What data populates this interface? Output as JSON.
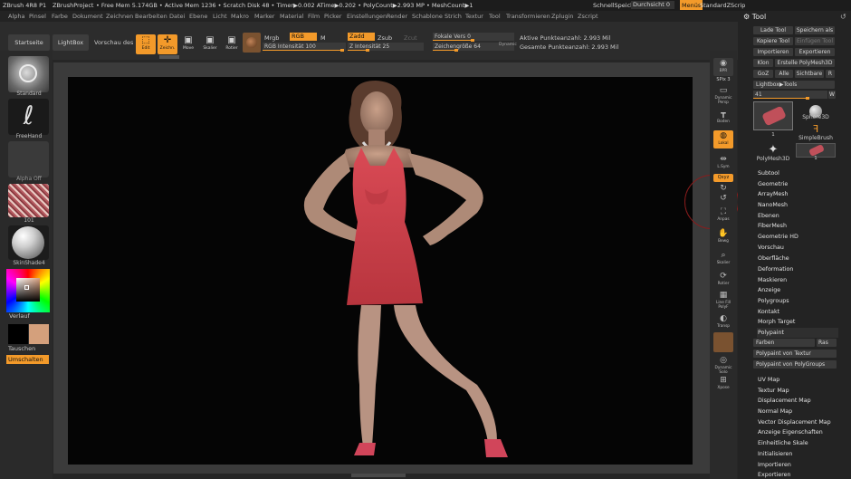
{
  "titlebar": {
    "app": "ZBrush 4R8 P1",
    "project": "ZBrushProject",
    "stats": "• Free Mem 5.174GB • Active Mem 1236 • Scratch Disk 48 • Timer▶0.002 ATime▶0.202 • PolyCount▶2.993 MP • MeshCount▶1",
    "quicksave": "SchnellSpeiche",
    "transparency": "Durchsicht 0",
    "menus": "Menüs",
    "script": "StandardZScrip"
  },
  "menubar": [
    "Alpha",
    "Pinsel",
    "Farbe",
    "Dokument",
    "Zeichnen",
    "Bearbeiten",
    "Datei",
    "Ebene",
    "Licht",
    "Makro",
    "Marker",
    "Material",
    "Film",
    "Picker",
    "Einstellungen",
    "Render",
    "Schablone",
    "Strich",
    "Textur",
    "Tool",
    "Transformieren",
    "Zplugin",
    "Zscript"
  ],
  "toolbar": {
    "startseite": "Startseite",
    "lightbox": "LightBox",
    "preview": "Vorschau des B",
    "edit": "Edit",
    "draw": "Zeichn.",
    "move": "Move",
    "scale": "Skalier",
    "rotate": "Rotier",
    "mrgb": "Mrgb",
    "rgb": "RGB",
    "m": "M",
    "rgb_intensity_label": "RGB Intensität",
    "rgb_intensity_value": "100",
    "zadd": "Zadd",
    "zsub": "Zsub",
    "zcut": "Zcut",
    "z_intensity_label": "Z Intensität",
    "z_intensity_value": "25",
    "focal_label": "Fokale Vers",
    "focal_value": "0",
    "draw_size_label": "Zeichengröße",
    "draw_size_value": "64",
    "dynamic": "Dynamic",
    "active_points": "Aktive Punkteanzahl: 2.993 Mil",
    "total_points": "Gesamte Punkteanzahl: 2.993 Mil"
  },
  "leftshelf": {
    "brush1": "Standard",
    "brush2": "FreeHand",
    "alpha": "Alpha Off",
    "texture_num": "101",
    "material": "SkinShade4",
    "gradient": "Verlauf",
    "swap": "Tauschen",
    "switch": "Umschalten"
  },
  "rightshelf": [
    "BPR",
    "SPix 3",
    "Dynamic Persp",
    "Boden",
    "Lokal",
    "L.Sym",
    "Qxyz",
    "",
    "",
    "Anpas",
    "Bewg",
    "Skalier",
    "Rotier",
    "Line Fill PolyF",
    "Transp",
    "Dynamic Solo",
    "Xpose"
  ],
  "palette": {
    "title": "Tool",
    "load": "Lade Tool",
    "save_as": "Speichern als",
    "copy": "Kopiere Tool",
    "paste": "Einfügen Tool",
    "import": "Importieren",
    "export": "Exportieren",
    "clone": "Klon",
    "make_polymesh": "Erstelle PolyMesh3D",
    "goz": "GoZ",
    "all": "Alle",
    "visible": "Sichtbare",
    "r": "R",
    "lightbox_tools": "Lightbox▶Tools",
    "slider_value": "41",
    "w": "W",
    "tools": [
      {
        "name": "",
        "count": "1"
      },
      {
        "name": "Sphere3D",
        "count": ""
      },
      {
        "name": "",
        "count": "1"
      },
      {
        "name": "SimpleBrush",
        "count": ""
      },
      {
        "name": "PolyMesh3D",
        "count": ""
      },
      {
        "name": "",
        "count": "1"
      }
    ],
    "subpalettes": [
      "Subtool",
      "Geometrie",
      "ArrayMesh",
      "NanoMesh",
      "Ebenen",
      "FiberMesh",
      "Geometrie HD",
      "Vorschau",
      "Oberfläche",
      "Deformation",
      "Maskieren",
      "Anzeige",
      "Polygroups",
      "Kontakt",
      "Morph Target",
      "Polypaint"
    ],
    "polypaint": {
      "colors": "Farben",
      "grid": "Ras",
      "from_texture": "Polypaint von Textur",
      "from_polygroups": "Polypaint von PolyGroups"
    },
    "subpalettes2": [
      "UV Map",
      "Textur Map",
      "Displacement Map",
      "Normal Map",
      "Vector Displacement Map",
      "Anzeige Eigenschaften",
      "Einheitliche Skale",
      "Initialisieren",
      "Importieren",
      "Exportieren"
    ]
  },
  "colors": {
    "accent": "#f39a2a",
    "background": "#262626",
    "canvas": "#050505"
  }
}
